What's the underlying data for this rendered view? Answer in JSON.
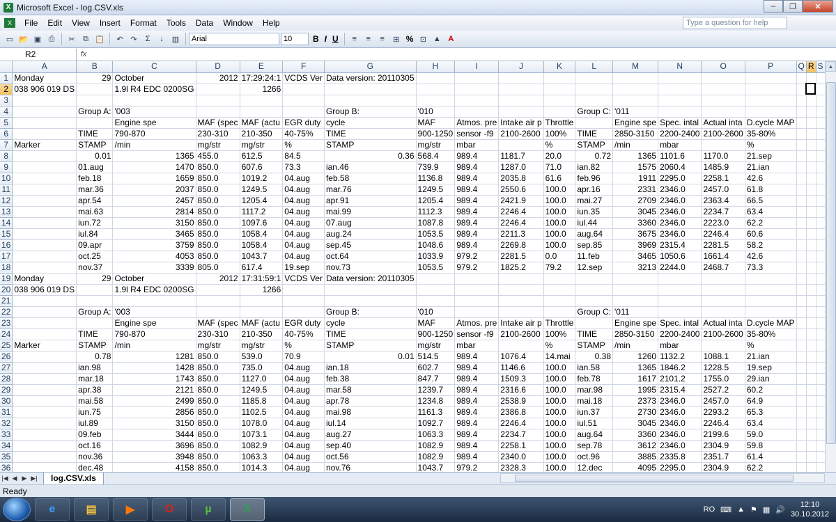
{
  "window": {
    "title": "Microsoft Excel - log.CSV.xls",
    "minimize": "–",
    "maximize": "❐",
    "close": "✕"
  },
  "menu": {
    "items": [
      "File",
      "Edit",
      "View",
      "Insert",
      "Format",
      "Tools",
      "Data",
      "Window",
      "Help"
    ],
    "help_placeholder": "Type a question for help"
  },
  "toolbar": {
    "font": "Arial",
    "size": "10",
    "bold": "B",
    "italic": "I",
    "underline": "U",
    "percent": "%",
    "sigma": "Σ"
  },
  "formula_bar": {
    "name_box": "R2",
    "fx": "fx",
    "value": ""
  },
  "sheet": {
    "columns": [
      "A",
      "B",
      "C",
      "D",
      "E",
      "F",
      "G",
      "H",
      "I",
      "J",
      "K",
      "L",
      "M",
      "N",
      "O",
      "P",
      "Q",
      "R",
      "S"
    ],
    "selected_column": "R",
    "selected_row": "2",
    "rows": [
      [
        "Monday",
        "29",
        "October",
        "2012",
        "17:29:24:1",
        "VCDS Ver",
        "Data version: 20110305",
        "",
        "",
        "",
        "",
        "",
        "",
        "",
        "",
        "",
        "",
        "",
        ""
      ],
      [
        "038 906 019 DS",
        "",
        "1.9l R4 EDC 0200SG",
        "",
        "1266",
        "",
        "",
        "",
        "",
        "",
        "",
        "",
        "",
        "",
        "",
        "",
        "",
        "",
        ""
      ],
      [
        "",
        "",
        "",
        "",
        "",
        "",
        "",
        "",
        "",
        "",
        "",
        "",
        "",
        "",
        "",
        "",
        "",
        "",
        ""
      ],
      [
        "",
        "Group A:",
        "'003",
        "",
        "",
        "",
        "Group B:",
        "'010",
        "",
        "",
        "",
        "Group C:",
        "'011",
        "",
        "",
        "",
        "",
        "",
        ""
      ],
      [
        "",
        "",
        "Engine spe",
        "MAF (spec",
        "MAF (actu",
        "EGR duty",
        "cycle",
        "MAF",
        "Atmos. pre",
        "Intake air p",
        "Throttle",
        "",
        "Engine spe",
        "Spec. intal",
        "Actual inta",
        "D.cycle MAP",
        "",
        "",
        ""
      ],
      [
        "",
        "TIME",
        "790-870",
        "230-310",
        "210-350",
        "40-75%",
        "TIME",
        "900-1250",
        "sensor -f9",
        "2100-2600",
        "100%",
        "TIME",
        "2850-3150",
        "2200-2400",
        "2100-2600",
        "35-80%",
        "",
        "",
        ""
      ],
      [
        "Marker",
        "STAMP",
        "/min",
        "mg/str",
        "mg/str",
        "%",
        "STAMP",
        "mg/str",
        "mbar",
        "",
        "%",
        "STAMP",
        "/min",
        "mbar",
        "",
        "%",
        "",
        "",
        ""
      ],
      [
        "",
        "0.01",
        "1365",
        "455.0",
        "612.5",
        "84.5",
        "0.36",
        "568.4",
        "989.4",
        "1181.7",
        "20.0",
        "0.72",
        "1365",
        "1101.6",
        "1170.0",
        "21.sep",
        "",
        "",
        ""
      ],
      [
        "",
        "01.aug",
        "1470",
        "850.0",
        "607.6",
        "73.3",
        "ian.46",
        "739.9",
        "989.4",
        "1287.0",
        "71.0",
        "ian.82",
        "1575",
        "2060.4",
        "1485.9",
        "21.ian",
        "",
        "",
        ""
      ],
      [
        "",
        "feb.18",
        "1659",
        "850.0",
        "1019.2",
        "04.aug",
        "feb.58",
        "1136.8",
        "989.4",
        "2035.8",
        "61.6",
        "feb.96",
        "1911",
        "2295.0",
        "2258.1",
        "42.6",
        "",
        "",
        ""
      ],
      [
        "",
        "mar.36",
        "2037",
        "850.0",
        "1249.5",
        "04.aug",
        "mar.76",
        "1249.5",
        "989.4",
        "2550.6",
        "100.0",
        "apr.16",
        "2331",
        "2346.0",
        "2457.0",
        "61.8",
        "",
        "",
        ""
      ],
      [
        "",
        "apr.54",
        "2457",
        "850.0",
        "1205.4",
        "04.aug",
        "apr.91",
        "1205.4",
        "989.4",
        "2421.9",
        "100.0",
        "mai.27",
        "2709",
        "2346.0",
        "2363.4",
        "66.5",
        "",
        "",
        ""
      ],
      [
        "",
        "mai.63",
        "2814",
        "850.0",
        "1117.2",
        "04.aug",
        "mai.99",
        "1112.3",
        "989.4",
        "2246.4",
        "100.0",
        "iun.35",
        "3045",
        "2346.0",
        "2234.7",
        "63.4",
        "",
        "",
        ""
      ],
      [
        "",
        "iun.72",
        "3150",
        "850.0",
        "1097.6",
        "04.aug",
        "07.aug",
        "1087.8",
        "989.4",
        "2246.4",
        "100.0",
        "iul.44",
        "3360",
        "2346.0",
        "2223.0",
        "62.2",
        "",
        "",
        ""
      ],
      [
        "",
        "iul.84",
        "3465",
        "850.0",
        "1058.4",
        "04.aug",
        "aug.24",
        "1053.5",
        "989.4",
        "2211.3",
        "100.0",
        "aug.64",
        "3675",
        "2346.0",
        "2246.4",
        "60.6",
        "",
        "",
        ""
      ],
      [
        "",
        "09.apr",
        "3759",
        "850.0",
        "1058.4",
        "04.aug",
        "sep.45",
        "1048.6",
        "989.4",
        "2269.8",
        "100.0",
        "sep.85",
        "3969",
        "2315.4",
        "2281.5",
        "58.2",
        "",
        "",
        ""
      ],
      [
        "",
        "oct.25",
        "4053",
        "850.0",
        "1043.7",
        "04.aug",
        "oct.64",
        "1033.9",
        "979.2",
        "2281.5",
        "0.0",
        "11.feb",
        "3465",
        "1050.6",
        "1661.4",
        "42.6",
        "",
        "",
        ""
      ],
      [
        "",
        "nov.37",
        "3339",
        "805.0",
        "617.4",
        "19.sep",
        "nov.73",
        "1053.5",
        "979.2",
        "1825.2",
        "79.2",
        "12.sep",
        "3213",
        "2244.0",
        "2468.7",
        "73.3",
        "",
        "",
        ""
      ],
      [
        "Monday",
        "29",
        "October",
        "2012",
        "17:31:59:1",
        "VCDS Ver",
        "Data version: 20110305",
        "",
        "",
        "",
        "",
        "",
        "",
        "",
        "",
        "",
        "",
        "",
        ""
      ],
      [
        "038 906 019 DS",
        "",
        "1.9l R4 EDC 0200SG",
        "",
        "1266",
        "",
        "",
        "",
        "",
        "",
        "",
        "",
        "",
        "",
        "",
        "",
        "",
        "",
        ""
      ],
      [
        "",
        "",
        "",
        "",
        "",
        "",
        "",
        "",
        "",
        "",
        "",
        "",
        "",
        "",
        "",
        "",
        "",
        "",
        ""
      ],
      [
        "",
        "Group A:",
        "'003",
        "",
        "",
        "",
        "Group B:",
        "'010",
        "",
        "",
        "",
        "Group C:",
        "'011",
        "",
        "",
        "",
        "",
        "",
        ""
      ],
      [
        "",
        "",
        "Engine spe",
        "MAF (spec",
        "MAF (actu",
        "EGR duty",
        "cycle",
        "MAF",
        "Atmos. pre",
        "Intake air p",
        "Throttle",
        "",
        "Engine spe",
        "Spec. intal",
        "Actual inta",
        "D.cycle MAP",
        "",
        "",
        ""
      ],
      [
        "",
        "TIME",
        "790-870",
        "230-310",
        "210-350",
        "40-75%",
        "TIME",
        "900-1250",
        "sensor -f9",
        "2100-2600",
        "100%",
        "TIME",
        "2850-3150",
        "2200-2400",
        "2100-2600",
        "35-80%",
        "",
        "",
        ""
      ],
      [
        "Marker",
        "STAMP",
        "/min",
        "mg/str",
        "mg/str",
        "%",
        "STAMP",
        "mg/str",
        "mbar",
        "",
        "%",
        "STAMP",
        "/min",
        "mbar",
        "",
        "%",
        "",
        "",
        ""
      ],
      [
        "",
        "0.78",
        "1281",
        "850.0",
        "539.0",
        "70.9",
        "0.01",
        "514.5",
        "989.4",
        "1076.4",
        "14.mai",
        "0.38",
        "1260",
        "1132.2",
        "1088.1",
        "21.ian",
        "",
        "",
        ""
      ],
      [
        "",
        "ian.98",
        "1428",
        "850.0",
        "735.0",
        "04.aug",
        "ian.18",
        "602.7",
        "989.4",
        "1146.6",
        "100.0",
        "ian.58",
        "1365",
        "1846.2",
        "1228.5",
        "19.sep",
        "",
        "",
        ""
      ],
      [
        "",
        "mar.18",
        "1743",
        "850.0",
        "1127.0",
        "04.aug",
        "feb.38",
        "847.7",
        "989.4",
        "1509.3",
        "100.0",
        "feb.78",
        "1617",
        "2101.2",
        "1755.0",
        "29.ian",
        "",
        "",
        ""
      ],
      [
        "",
        "apr.38",
        "2121",
        "850.0",
        "1249.5",
        "04.aug",
        "mar.58",
        "1239.7",
        "989.4",
        "2316.6",
        "100.0",
        "mar.98",
        "1995",
        "2315.4",
        "2527.2",
        "60.2",
        "",
        "",
        ""
      ],
      [
        "",
        "mai.58",
        "2499",
        "850.0",
        "1185.8",
        "04.aug",
        "apr.78",
        "1234.8",
        "989.4",
        "2538.9",
        "100.0",
        "mai.18",
        "2373",
        "2346.0",
        "2457.0",
        "64.9",
        "",
        "",
        ""
      ],
      [
        "",
        "iun.75",
        "2856",
        "850.0",
        "1102.5",
        "04.aug",
        "mai.98",
        "1161.3",
        "989.4",
        "2386.8",
        "100.0",
        "iun.37",
        "2730",
        "2346.0",
        "2293.2",
        "65.3",
        "",
        "",
        ""
      ],
      [
        "",
        "iul.89",
        "3150",
        "850.0",
        "1078.0",
        "04.aug",
        "iul.14",
        "1092.7",
        "989.4",
        "2246.4",
        "100.0",
        "iul.51",
        "3045",
        "2346.0",
        "2246.4",
        "63.4",
        "",
        "",
        ""
      ],
      [
        "",
        "09.feb",
        "3444",
        "850.0",
        "1073.1",
        "04.aug",
        "aug.27",
        "1063.3",
        "989.4",
        "2234.7",
        "100.0",
        "aug.64",
        "3360",
        "2346.0",
        "2199.6",
        "59.0",
        "",
        "",
        ""
      ],
      [
        "",
        "oct.16",
        "3696",
        "850.0",
        "1082.9",
        "04.aug",
        "sep.40",
        "1082.9",
        "989.4",
        "2258.1",
        "100.0",
        "sep.78",
        "3612",
        "2346.0",
        "2304.9",
        "59.8",
        "",
        "",
        ""
      ],
      [
        "",
        "nov.36",
        "3948",
        "850.0",
        "1063.3",
        "04.aug",
        "oct.56",
        "1082.9",
        "989.4",
        "2340.0",
        "100.0",
        "oct.96",
        "3885",
        "2335.8",
        "2351.7",
        "61.4",
        "",
        "",
        ""
      ],
      [
        "",
        "dec.48",
        "4158",
        "850.0",
        "1014.3",
        "04.aug",
        "nov.76",
        "1043.7",
        "979.2",
        "2328.3",
        "100.0",
        "12.dec",
        "4095",
        "2295.0",
        "2304.9",
        "62.2",
        "",
        "",
        ""
      ]
    ]
  },
  "sheet_tabs": [
    "log.CSV.xls"
  ],
  "status": "Ready",
  "taskbar": {
    "lang": "RO",
    "time": "12:10",
    "date": "30.10.2012"
  }
}
